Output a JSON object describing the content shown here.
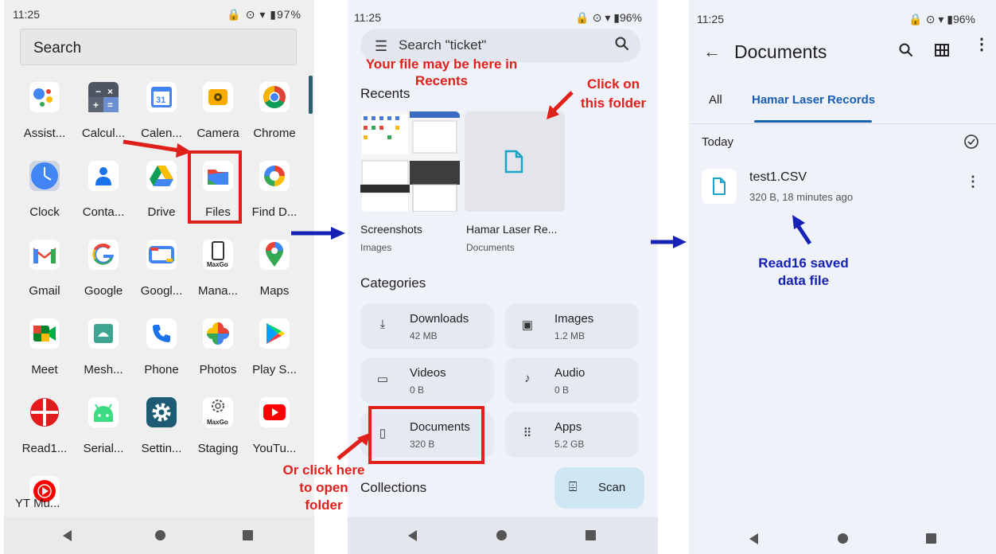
{
  "panel1": {
    "status_time": "11:25",
    "status_icons": "🔒 ⊙ ▾ ▮97%",
    "search_label": "Search",
    "apps": [
      {
        "label": "Assist...",
        "icon": "assistant-icon"
      },
      {
        "label": "Calcul...",
        "icon": "calculator-icon"
      },
      {
        "label": "Calen...",
        "icon": "calendar-icon",
        "glyph": "31"
      },
      {
        "label": "Camera",
        "icon": "camera-icon"
      },
      {
        "label": "Chrome",
        "icon": "chrome-icon"
      },
      {
        "label": "Clock",
        "icon": "clock-icon"
      },
      {
        "label": "Conta...",
        "icon": "contacts-icon"
      },
      {
        "label": "Drive",
        "icon": "drive-icon"
      },
      {
        "label": "Files",
        "icon": "files-icon"
      },
      {
        "label": "Find D...",
        "icon": "find-device-icon"
      },
      {
        "label": "Gmail",
        "icon": "gmail-icon",
        "glyph": "M"
      },
      {
        "label": "Google",
        "icon": "google-icon",
        "glyph": "G"
      },
      {
        "label": "Googl...",
        "icon": "google-tv-icon"
      },
      {
        "label": "Mana...",
        "icon": "maxgo-manager-icon",
        "glyph": "MaxGo"
      },
      {
        "label": "Maps",
        "icon": "maps-icon"
      },
      {
        "label": "Meet",
        "icon": "meet-icon"
      },
      {
        "label": "Mesh...",
        "icon": "mesh-icon"
      },
      {
        "label": "Phone",
        "icon": "phone-icon"
      },
      {
        "label": "Photos",
        "icon": "photos-icon"
      },
      {
        "label": "Play S...",
        "icon": "play-store-icon"
      },
      {
        "label": "Read1...",
        "icon": "read16-icon"
      },
      {
        "label": "Serial...",
        "icon": "serial-icon"
      },
      {
        "label": "Settin...",
        "icon": "settings-icon"
      },
      {
        "label": "Staging",
        "icon": "maxgo-staging-icon",
        "glyph": "MaxGo"
      },
      {
        "label": "YouTu...",
        "icon": "youtube-icon"
      },
      {
        "label": "YT Mu...",
        "icon": "yt-music-icon"
      }
    ],
    "annotation_arrow": "red-arrow-to-files"
  },
  "panel2": {
    "status_time": "11:25",
    "status_icons": "🔒 ⊙ ▾ ▮96%",
    "search_text": "Search \"ticket\"",
    "recents_title": "Recents",
    "recents": [
      {
        "name": "Screenshots",
        "sub": "Images"
      },
      {
        "name": "Hamar Laser Re...",
        "sub": "Documents"
      }
    ],
    "categories_title": "Categories",
    "categories": [
      {
        "name": "Downloads",
        "size": "42 MB",
        "icon": "download-icon",
        "glyph": "⤓"
      },
      {
        "name": "Images",
        "size": "1.2 MB",
        "icon": "image-icon",
        "glyph": "▣"
      },
      {
        "name": "Videos",
        "size": "0 B",
        "icon": "video-icon",
        "glyph": "▭"
      },
      {
        "name": "Audio",
        "size": "0 B",
        "icon": "audio-icon",
        "glyph": "♪"
      },
      {
        "name": "Documents",
        "size": "320 B",
        "icon": "document-icon",
        "glyph": "▯"
      },
      {
        "name": "Apps",
        "size": "5.2 GB",
        "icon": "apps-icon",
        "glyph": "⠿"
      }
    ],
    "collections_title": "Collections",
    "scan_label": "Scan",
    "ann_recents": "Your file may be here in Recents",
    "ann_click": "Click on this folder",
    "ann_or": "Or click here to open folder"
  },
  "panel3": {
    "status_time": "11:25",
    "status_icons": "🔒 ⊙ ▾ ▮96%",
    "title": "Documents",
    "tabs": [
      "All",
      "Hamar Laser Records"
    ],
    "section": "Today",
    "file_name": "test1.CSV",
    "file_meta": "320 B, 18 minutes ago",
    "ann_saved": "Read16 saved data file"
  },
  "colors": {
    "annotation_red": "#e0201b",
    "annotation_blue": "#1622b5",
    "accent_blue": "#1a5fb4"
  }
}
